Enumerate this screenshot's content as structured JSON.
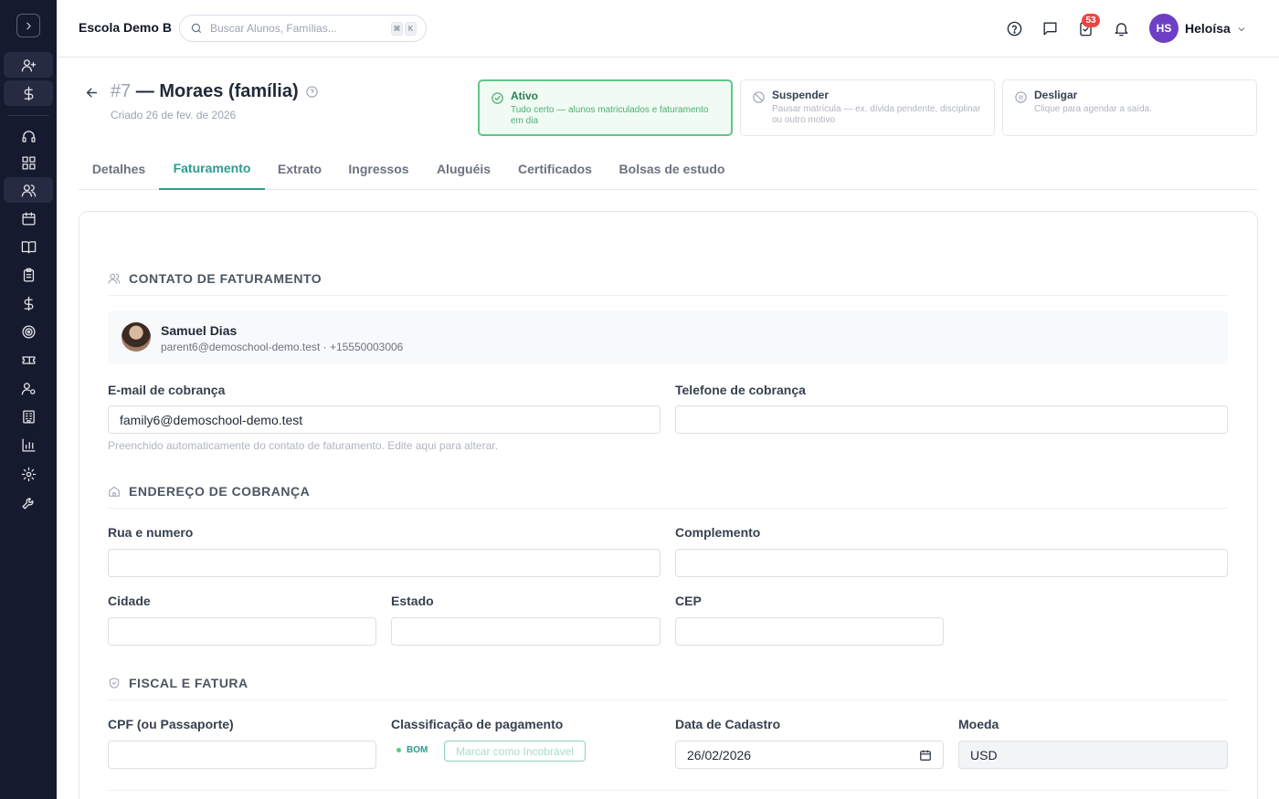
{
  "app": {
    "school_name": "Escola Demo B",
    "search_placeholder": "Buscar Alunos, Famílias...",
    "kbd_cmd": "⌘",
    "kbd_k": "K",
    "notification_count": "53",
    "user_initials": "HS",
    "user_name": "Heloísa"
  },
  "sidebar": {
    "items": [
      {
        "icon": "user-plus-icon"
      },
      {
        "icon": "dollar-icon"
      },
      {
        "icon": "headset-icon"
      },
      {
        "icon": "grid-icon"
      },
      {
        "icon": "users-icon"
      },
      {
        "icon": "calendar-icon"
      },
      {
        "icon": "book-icon"
      },
      {
        "icon": "clipboard-icon"
      },
      {
        "icon": "dollar-icon"
      },
      {
        "icon": "target-icon"
      },
      {
        "icon": "ticket-icon"
      },
      {
        "icon": "user-cog-icon"
      },
      {
        "icon": "building-icon"
      },
      {
        "icon": "chart-icon"
      },
      {
        "icon": "settings-icon"
      },
      {
        "icon": "wrench-icon"
      }
    ]
  },
  "header": {
    "number": "#7",
    "title": " — Moraes (família)",
    "created": "Criado 26 de fev. de 2026"
  },
  "status": {
    "active": {
      "title": "Ativo",
      "desc": "Tudo certo — alunos matriculados e faturamento em dia"
    },
    "suspend": {
      "title": "Suspender",
      "desc": "Pausar matrícula — ex. dívida pendente, disciplinar ou outro motivo"
    },
    "terminate": {
      "title": "Desligar",
      "desc": "Clique para agendar a saída."
    }
  },
  "tabs": [
    "Detalhes",
    "Faturamento",
    "Extrato",
    "Ingressos",
    "Aluguéis",
    "Certificados",
    "Bolsas de estudo"
  ],
  "billing_contact": {
    "section_title": "CONTATO DE FATURAMENTO",
    "name": "Samuel Dias",
    "details": "parent6@demoschool-demo.test · +15550003006",
    "email_label": "E-mail de cobrança",
    "email_value": "family6@demoschool-demo.test",
    "phone_label": "Telefone de cobrança",
    "phone_value": "",
    "hint": "Preenchido automaticamente do contato de faturamento. Edite aqui para alterar."
  },
  "billing_address": {
    "section_title": "ENDEREÇO DE COBRANÇA",
    "street_label": "Rua e numero",
    "complement_label": "Complemento",
    "city_label": "Cidade",
    "state_label": "Estado",
    "zip_label": "CEP"
  },
  "fiscal": {
    "section_title": "FISCAL E FATURA",
    "cpf_label": "CPF (ou Passaporte)",
    "rating_label": "Classificação de pagamento",
    "rating_value": "BOM",
    "mark_button": "Marcar como Incobrável",
    "signup_label": "Data de Cadastro",
    "signup_value": "26/02/2026",
    "currency_label": "Moeda",
    "currency_value": "USD"
  }
}
